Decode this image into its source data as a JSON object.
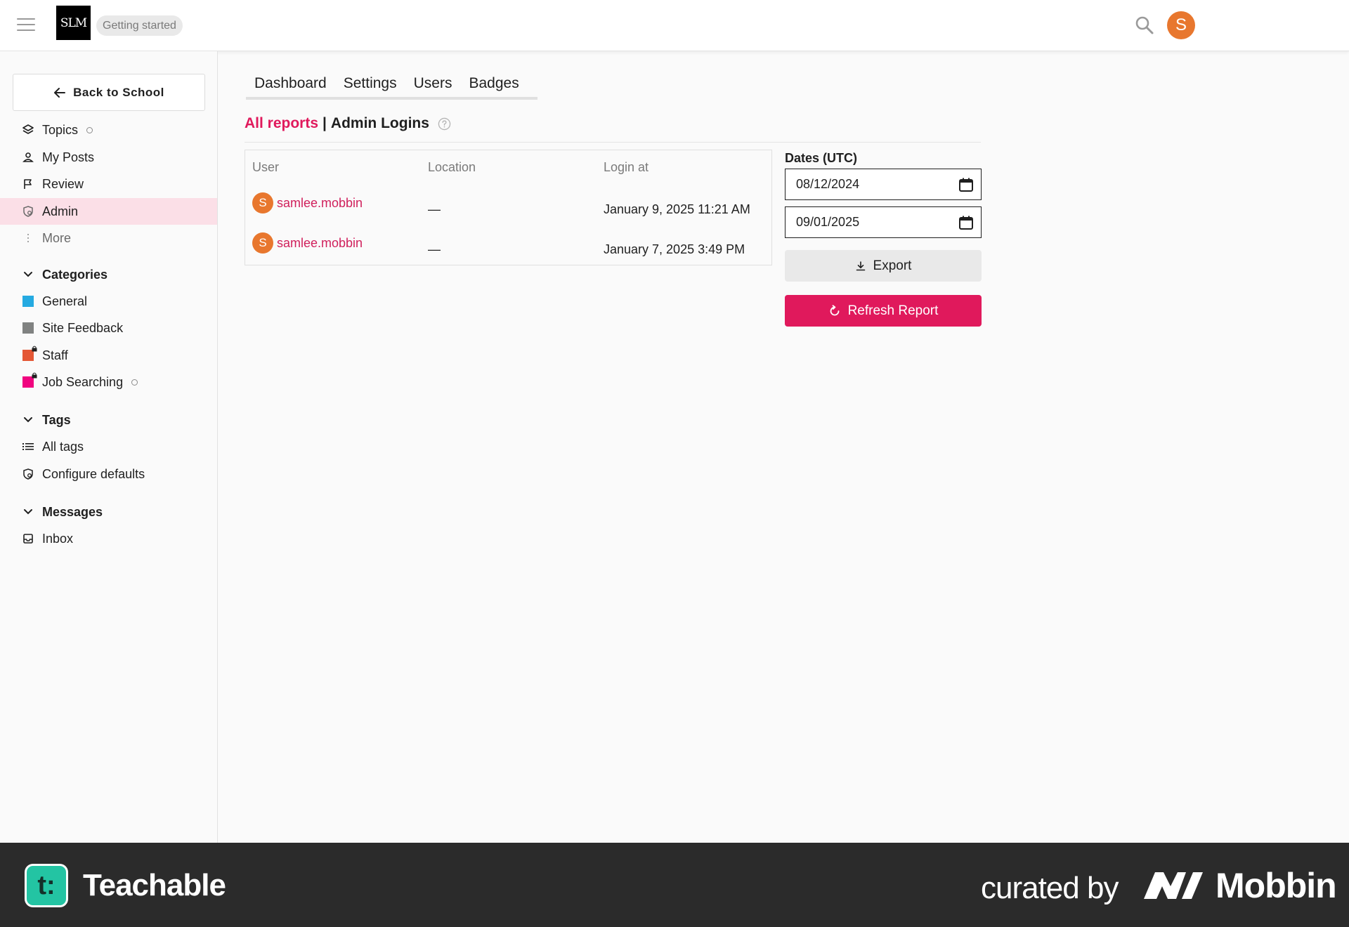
{
  "header": {
    "logo_text": "SLM",
    "pill_label": "Getting started",
    "avatar_initial": "S"
  },
  "sidebar": {
    "back_label": "Back to School",
    "nav": [
      {
        "label": "Topics"
      },
      {
        "label": "My Posts"
      },
      {
        "label": "Review"
      },
      {
        "label": "Admin"
      },
      {
        "label": "More"
      }
    ],
    "categories": {
      "title": "Categories",
      "items": [
        {
          "label": "General",
          "color": "#25aae1"
        },
        {
          "label": "Site Feedback",
          "color": "#808281"
        },
        {
          "label": "Staff",
          "color": "#e45735"
        },
        {
          "label": "Job Searching",
          "color": "#f0047f"
        }
      ]
    },
    "tags": {
      "title": "Tags",
      "items": [
        {
          "label": "All tags"
        },
        {
          "label": "Configure defaults"
        }
      ]
    },
    "messages": {
      "title": "Messages",
      "items": [
        {
          "label": "Inbox"
        }
      ]
    }
  },
  "main": {
    "tabs": [
      {
        "label": "Dashboard"
      },
      {
        "label": "Settings"
      },
      {
        "label": "Users"
      },
      {
        "label": "Badges"
      }
    ],
    "breadcrumb": {
      "link": "All reports",
      "separator": "|",
      "current": "Admin Logins"
    },
    "table": {
      "headers": [
        "User",
        "Location",
        "Login at"
      ],
      "rows": [
        {
          "avatar": "S",
          "user": "samlee.mobbin",
          "location": "—",
          "login_at": "January 9, 2025 11:21 AM"
        },
        {
          "avatar": "S",
          "user": "samlee.mobbin",
          "location": "—",
          "login_at": "January 7, 2025 3:49 PM"
        }
      ]
    },
    "filters": {
      "dates_label": "Dates (UTC)",
      "start_date": "08/12/2024",
      "end_date": "09/01/2025",
      "export_label": "Export",
      "refresh_label": "Refresh Report"
    }
  },
  "footer": {
    "brand": "Teachable",
    "brand_logo": "t:",
    "curated_by": "curated by",
    "curator": "Mobbin"
  },
  "colors": {
    "accent": "#e0195c",
    "avatar": "#e8772e",
    "active_nav_bg": "#fbdfe7",
    "footer_bg": "#2b2b2b",
    "teachable_green": "#23c4a3"
  }
}
